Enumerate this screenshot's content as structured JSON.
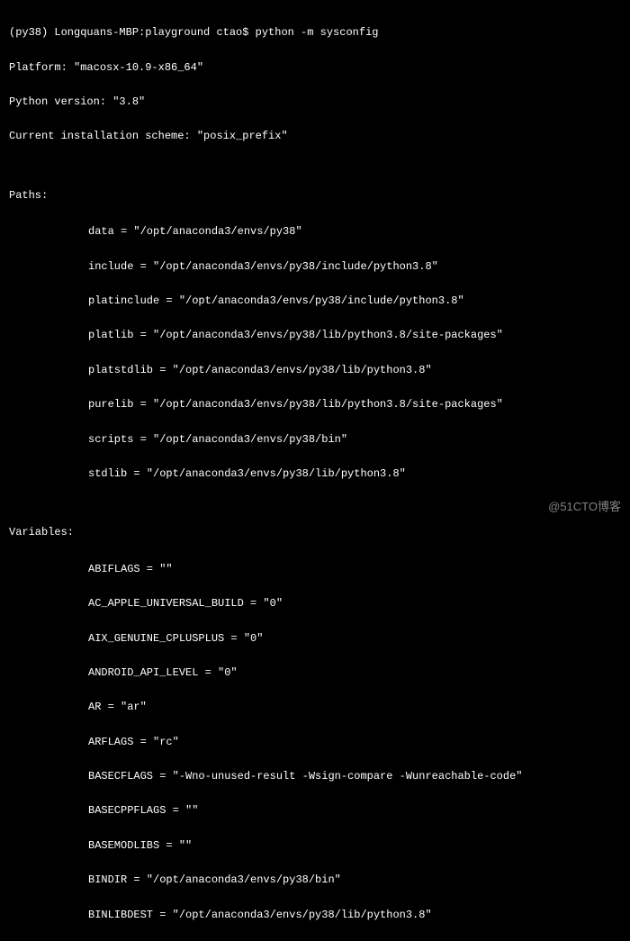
{
  "prompt": "(py38) Longquans-MBP:playground ctao$ python -m sysconfig",
  "header": {
    "platform_label": "Platform: \"macosx-10.9-x86_64\"",
    "python_version_label": "Python version: \"3.8\"",
    "scheme_label": "Current installation scheme: \"posix_prefix\""
  },
  "paths_header": "Paths:",
  "paths": {
    "data": "data = \"/opt/anaconda3/envs/py38\"",
    "include": "include = \"/opt/anaconda3/envs/py38/include/python3.8\"",
    "platinclude": "platinclude = \"/opt/anaconda3/envs/py38/include/python3.8\"",
    "platlib": "platlib = \"/opt/anaconda3/envs/py38/lib/python3.8/site-packages\"",
    "platstdlib": "platstdlib = \"/opt/anaconda3/envs/py38/lib/python3.8\"",
    "purelib": "purelib = \"/opt/anaconda3/envs/py38/lib/python3.8/site-packages\"",
    "scripts": "scripts = \"/opt/anaconda3/envs/py38/bin\"",
    "stdlib": "stdlib = \"/opt/anaconda3/envs/py38/lib/python3.8\""
  },
  "vars_header": "Variables:",
  "vars": {
    "abiflags": "ABIFLAGS = \"\"",
    "ac_apple": "AC_APPLE_UNIVERSAL_BUILD = \"0\"",
    "aix_genuine": "AIX_GENUINE_CPLUSPLUS = \"0\"",
    "android_api": "ANDROID_API_LEVEL = \"0\"",
    "ar": "AR = \"ar\"",
    "arflags": "ARFLAGS = \"rc\"",
    "basecflags": "BASECFLAGS = \"-Wno-unused-result -Wsign-compare -Wunreachable-code\"",
    "basecppflags": "BASECPPFLAGS = \"\"",
    "basemodlibs": "BASEMODLIBS = \"\"",
    "bindir": "BINDIR = \"/opt/anaconda3/envs/py38/bin\"",
    "binlibdest": "BINLIBDEST = \"/opt/anaconda3/envs/py38/lib/python3.8\""
  },
  "watermark": "@51CTO博客"
}
